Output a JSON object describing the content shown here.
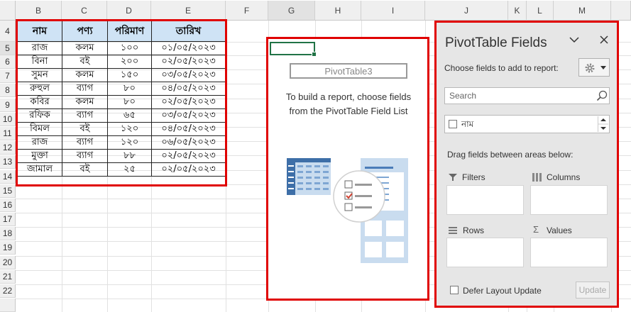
{
  "columns": [
    "B",
    "C",
    "D",
    "E",
    "F",
    "G",
    "H",
    "I",
    "J",
    "K",
    "L",
    "M"
  ],
  "rows": [
    "4",
    "5",
    "6",
    "7",
    "8",
    "9",
    "10",
    "11",
    "12",
    "13",
    "14",
    "15",
    "16",
    "17",
    "18",
    "19",
    "20",
    "21",
    "22"
  ],
  "table": {
    "headers": [
      "নাম",
      "পণ্য",
      "পরিমাণ",
      "তারিখ"
    ],
    "rows": [
      [
        "রাজ",
        "কলম",
        "১০০",
        "০১/০৫/২০২৩"
      ],
      [
        "বিনা",
        "বই",
        "২০০",
        "০২/০৫/২০২৩"
      ],
      [
        "সুমন",
        "কলম",
        "১৫০",
        "০৩/০৫/২০২৩"
      ],
      [
        "রুহুল",
        "ব্যাগ",
        "৮০",
        "০৪/০৫/২০২৩"
      ],
      [
        "কবির",
        "কলম",
        "৮০",
        "০২/০৫/২০২৩"
      ],
      [
        "রফিক",
        "ব্যাগ",
        "৬৫",
        "০৩/০৫/২০২৩"
      ],
      [
        "বিমল",
        "বই",
        "১২০",
        "০৪/০৫/২০২৩"
      ],
      [
        "রাজ",
        "ব্যাগ",
        "১২০",
        "০৬/০৫/২০২৩"
      ],
      [
        "মুক্তা",
        "ব্যাগ",
        "৮৮",
        "০২/০৫/২০২৩"
      ],
      [
        "জামাল",
        "বই",
        "২৫",
        "০২/০৫/২০২৩"
      ]
    ]
  },
  "pivot": {
    "title": "PivotTable3",
    "message_line1": "To build a report, choose fields",
    "message_line2": "from the PivotTable Field List"
  },
  "pane": {
    "title": "PivotTable Fields",
    "choose_label": "Choose fields to add to report:",
    "search_placeholder": "Search",
    "field_name": "নাম",
    "drag_label": "Drag fields between areas below:",
    "filters_label": "Filters",
    "columns_label": "Columns",
    "rows_label": "Rows",
    "values_label": "Values",
    "defer_label": "Defer Layout Update",
    "update_label": "Update"
  },
  "colors": {
    "highlight": "#e00000",
    "header_fill": "#cfe3f5",
    "pane_bg": "#e6e6e6"
  }
}
